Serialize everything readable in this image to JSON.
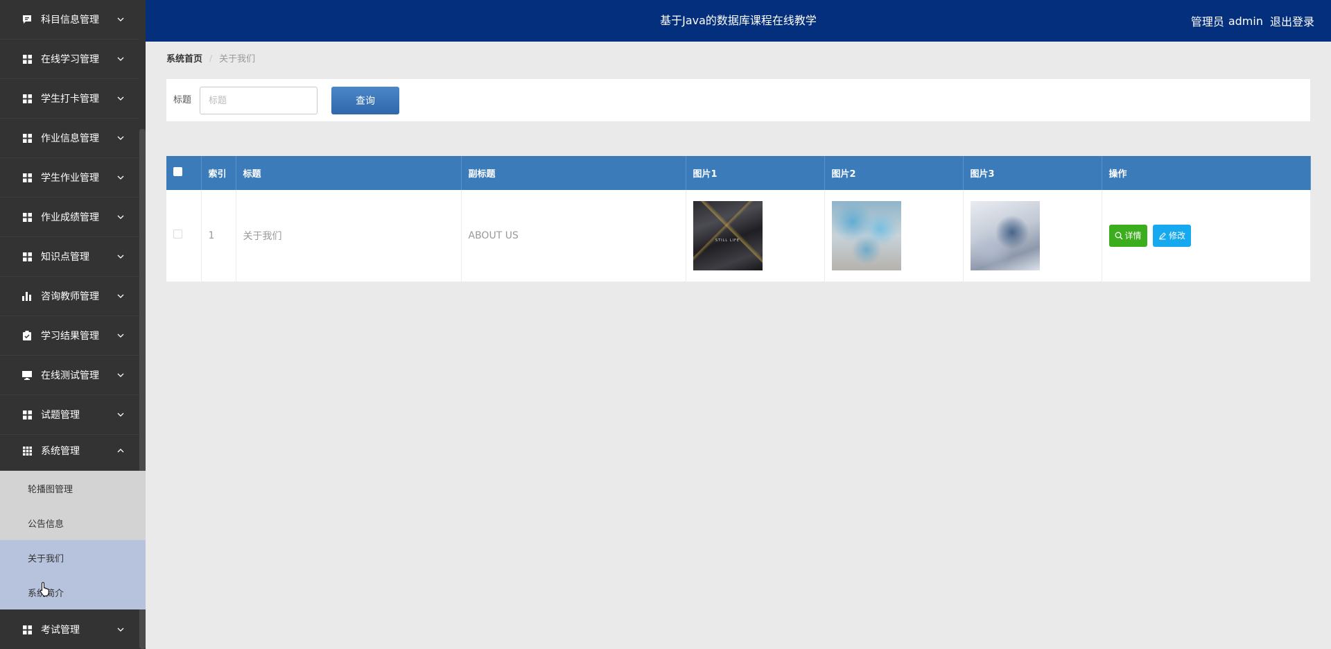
{
  "sidebar": {
    "menu": [
      {
        "label": "科目信息管理",
        "icon": "chat-icon"
      },
      {
        "label": "在线学习管理",
        "icon": "grid-icon"
      },
      {
        "label": "学生打卡管理",
        "icon": "grid-icon"
      },
      {
        "label": "作业信息管理",
        "icon": "grid-icon"
      },
      {
        "label": "学生作业管理",
        "icon": "grid-icon"
      },
      {
        "label": "作业成绩管理",
        "icon": "grid-icon"
      },
      {
        "label": "知识点管理",
        "icon": "grid-icon"
      },
      {
        "label": "咨询教师管理",
        "icon": "bar-chart-icon"
      },
      {
        "label": "学习结果管理",
        "icon": "clipboard-icon"
      },
      {
        "label": "在线测试管理",
        "icon": "monitor-icon"
      },
      {
        "label": "试题管理",
        "icon": "grid-icon"
      },
      {
        "label": "系统管理",
        "icon": "grid-9-icon"
      }
    ],
    "submenu": [
      "轮播图管理",
      "公告信息",
      "关于我们",
      "系统简介"
    ],
    "submenu_active": "关于我们",
    "bottom_item": {
      "label": "考试管理",
      "icon": "grid-icon"
    }
  },
  "header": {
    "title": "基于Java的数据库课程在线教学",
    "user_role": "管理员",
    "username": "admin",
    "logout": "退出登录"
  },
  "breadcrumb": {
    "home": "系统首页",
    "separator": "/",
    "current": "关于我们"
  },
  "search": {
    "label": "标题",
    "placeholder": "标题",
    "value": "",
    "button": "查询"
  },
  "table": {
    "headers": [
      "索引",
      "标题",
      "副标题",
      "图片1",
      "图片2",
      "图片3",
      "操作"
    ],
    "rows": [
      {
        "index": "1",
        "title": "关于我们",
        "subtitle": "ABOUT US",
        "detail_button": "详情",
        "edit_button": "修改"
      }
    ]
  },
  "colors": {
    "sidebar_bg": "#333333",
    "header_bg": "#042f7d",
    "table_header_bg": "#3b7bb9",
    "detail_button": "#3cae1e",
    "edit_button": "#17a9f0",
    "submenu_active_bg": "#b7c3dc"
  }
}
